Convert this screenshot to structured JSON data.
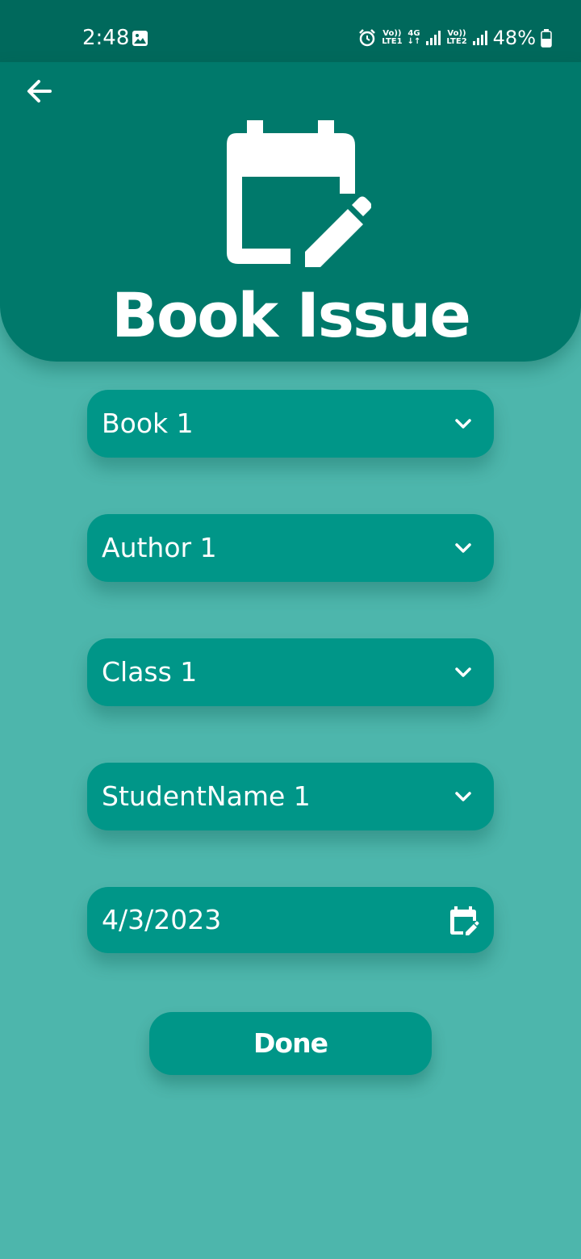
{
  "status_bar": {
    "time": "2:48",
    "battery": "48%",
    "sim1_label_top": "Vo))",
    "sim1_label_bottom": "LTE1",
    "network_type": "4G",
    "sim2_label_top": "Vo))",
    "sim2_label_bottom": "LTE2"
  },
  "header": {
    "title": "Book Issue",
    "icon": "edit-calendar-icon"
  },
  "form": {
    "book": {
      "value": "Book 1",
      "icon": "chevron-down-icon"
    },
    "author": {
      "value": "Author 1",
      "icon": "chevron-down-icon"
    },
    "class": {
      "value": "Class 1",
      "icon": "chevron-down-icon"
    },
    "student": {
      "value": "StudentName 1",
      "icon": "chevron-down-icon"
    },
    "date": {
      "value": "4/3/2023",
      "icon": "edit-calendar-icon"
    }
  },
  "actions": {
    "done_label": "Done"
  },
  "colors": {
    "background": "#4db6ac",
    "header": "#00796b",
    "status_bar": "#00695c",
    "field": "#009688",
    "text": "#ffffff"
  }
}
